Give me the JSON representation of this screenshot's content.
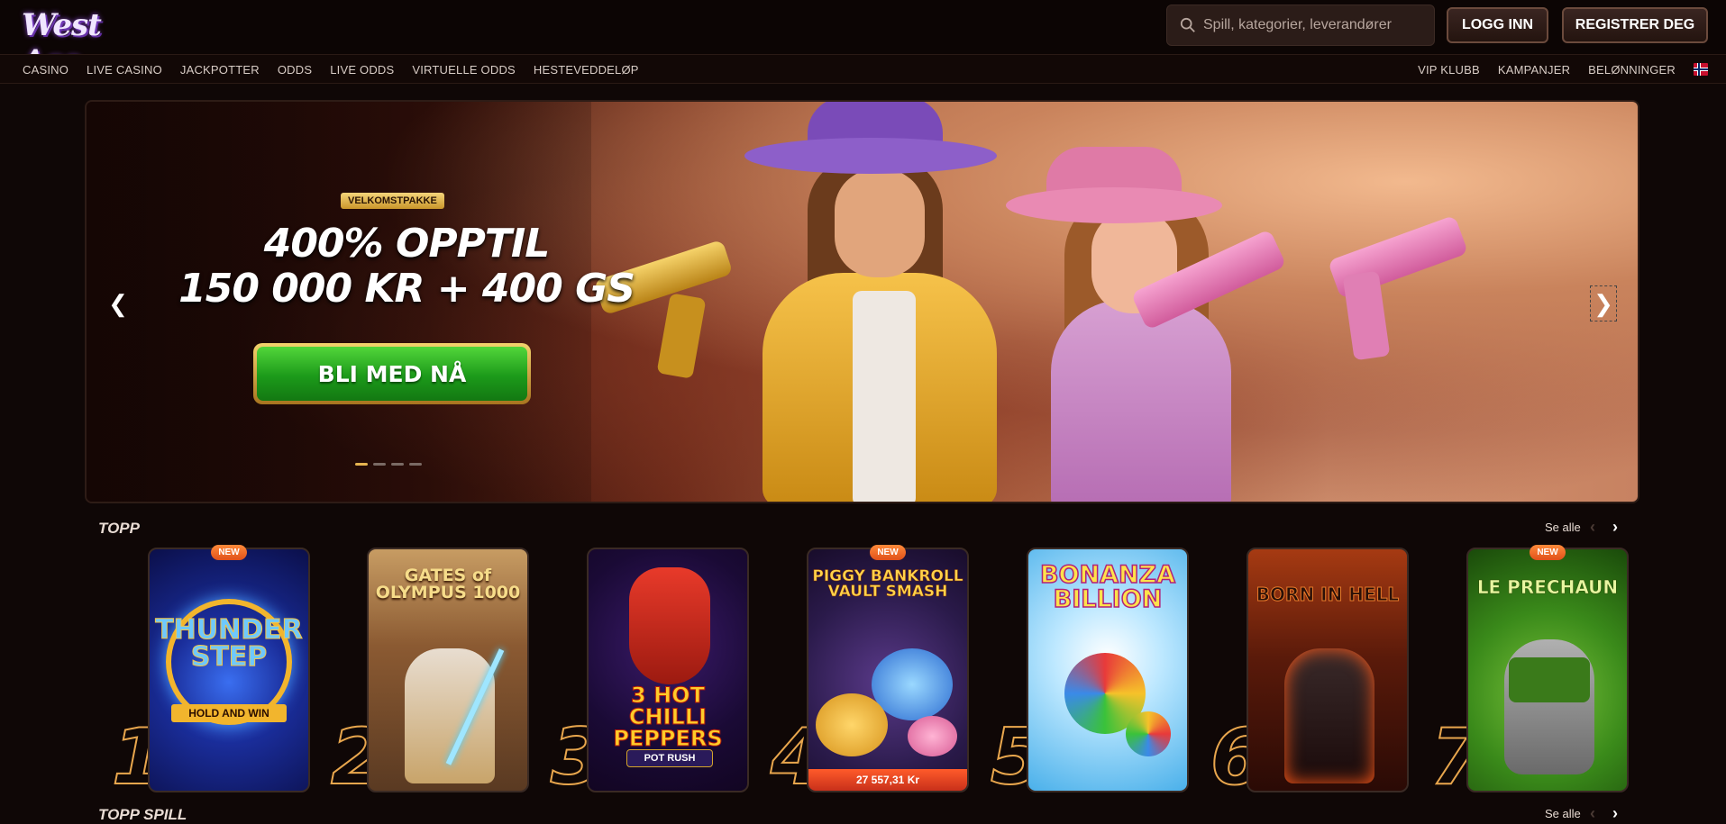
{
  "header": {
    "logo_text": "West Ace",
    "search_placeholder": "Spill, kategorier, leverandører",
    "login_label": "LOGG INN",
    "register_label": "REGISTRER DEG"
  },
  "nav": {
    "left": [
      "CASINO",
      "LIVE CASINO",
      "JACKPOTTER",
      "ODDS",
      "LIVE ODDS",
      "VIRTUELLE ODDS",
      "HESTEVEDDELØP"
    ],
    "right": [
      "VIP KLUBB",
      "KAMPANJER",
      "BELØNNINGER"
    ],
    "language_flag": "norway-flag"
  },
  "hero": {
    "badge": "VELKOMSTPAKKE",
    "line1": "400% OPPTIL",
    "line2": "150 000 KR + 400 GS",
    "cta": "BLI MED NÅ",
    "slides_total": 4,
    "active_slide": 1
  },
  "top_section": {
    "title": "TOPP",
    "see_all": "Se alle",
    "games": [
      {
        "rank": "1",
        "title": "THUNDER STEP",
        "subtitle": "HOLD AND WIN",
        "is_new": true,
        "new_label": "NEW"
      },
      {
        "rank": "2",
        "title": "GATES of OLYMPUS 1000",
        "subtitle": "",
        "is_new": false
      },
      {
        "rank": "3",
        "title": "3 HOT CHILLI PEPPERS",
        "subtitle": "POT RUSH",
        "is_new": false
      },
      {
        "rank": "4",
        "title": "PIGGY BANKROLL VAULT SMASH",
        "subtitle": "",
        "is_new": true,
        "new_label": "NEW",
        "jackpot": "27 557,31 Kr"
      },
      {
        "rank": "5",
        "title": "BONANZA BILLION",
        "subtitle": "",
        "is_new": false
      },
      {
        "rank": "6",
        "title": "BORN IN HELL",
        "subtitle": "",
        "is_new": false
      },
      {
        "rank": "7",
        "title": "LE PRECHAUN",
        "subtitle": "",
        "is_new": true,
        "new_label": "NEW"
      }
    ]
  },
  "top_games_section": {
    "title": "TOPP SPILL",
    "see_all": "Se alle"
  },
  "colors": {
    "background": "#0f0706",
    "accent_gold": "#e8a64d",
    "cta_green": "#1c9a1a",
    "new_badge": "#e0501a"
  }
}
